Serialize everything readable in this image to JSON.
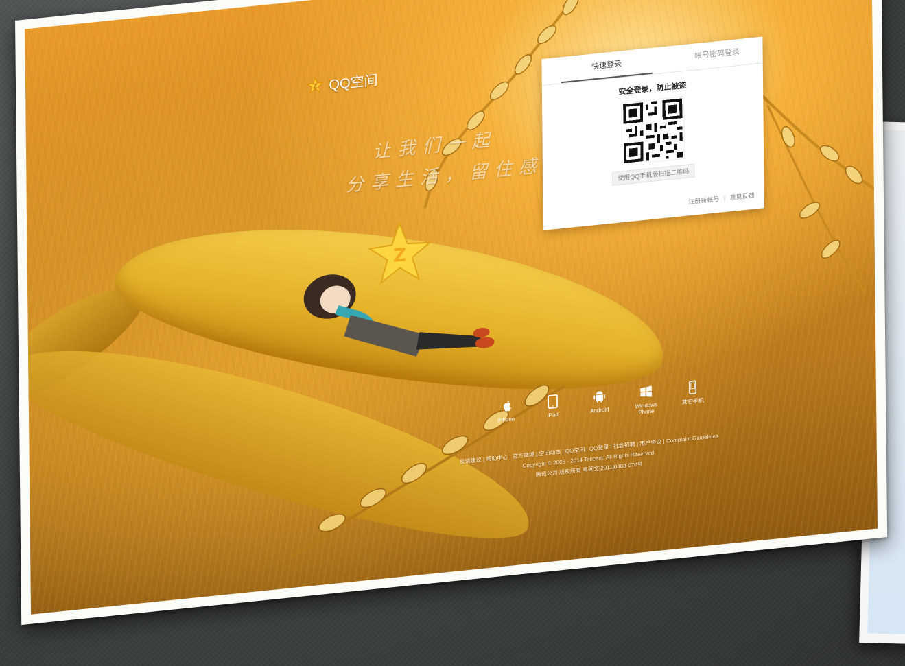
{
  "brand": {
    "name": "QQ空间"
  },
  "slogan": {
    "line1": "让我们一起",
    "line2": "分享生活，留住感动"
  },
  "login": {
    "tabs": [
      {
        "label": "快速登录",
        "active": true
      },
      {
        "label": "帐号密码登录",
        "active": false
      }
    ],
    "headline": "安全登录，防止被盗",
    "qr_hint": "使用QQ手机版扫描二维码",
    "links": {
      "register": "注册新帐号",
      "feedback": "意见反馈"
    }
  },
  "devices": [
    {
      "label": "iPhone",
      "icon": "apple-icon"
    },
    {
      "label": "iPad",
      "icon": "tablet-icon"
    },
    {
      "label": "Android",
      "icon": "android-icon"
    },
    {
      "label": "Windows Phone",
      "icon": "windows-icon"
    },
    {
      "label": "其它手机",
      "icon": "phone-icon"
    }
  ],
  "footer": {
    "links": [
      "反馈建议",
      "帮助中心",
      "官方微博",
      "空间动态",
      "QQ空间",
      "QQ登录",
      "社会招聘",
      "用户协议",
      "Complaint Guidelines"
    ],
    "copyright": "Copyright © 2005 - 2014 Tencent. All Rights Reserved.",
    "company": "腾讯公司 版权所有 粤网文[2011]0483-070号"
  },
  "colors": {
    "accent": "#e8a22a",
    "brand_text": "#ffffff",
    "card_bg": "#ffffff"
  }
}
